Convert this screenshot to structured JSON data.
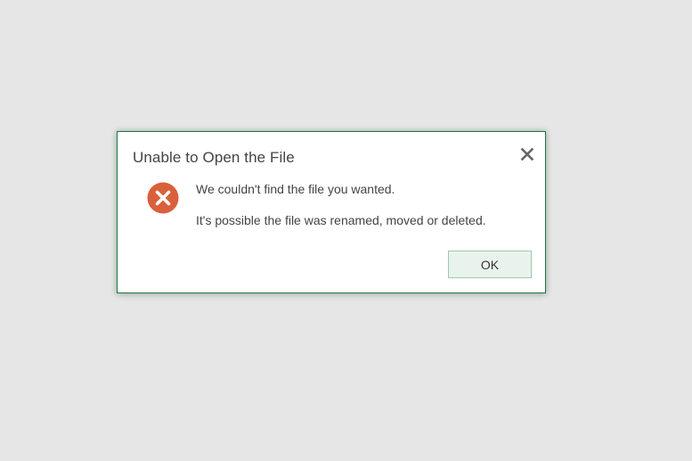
{
  "dialog": {
    "title": "Unable to Open the File",
    "close_icon": "close-icon",
    "error_icon": "error-x-icon",
    "message_line_1": "We couldn't find the file you wanted.",
    "message_line_2": "It's possible the file was renamed, moved or deleted.",
    "ok_label": "OK"
  },
  "colors": {
    "background": "#e6e6e6",
    "dialog_border": "#217346",
    "error_icon": "#d9603b",
    "ok_button_bg": "#e9f3ed",
    "ok_button_border": "#9fc8ad",
    "text": "#444444"
  }
}
